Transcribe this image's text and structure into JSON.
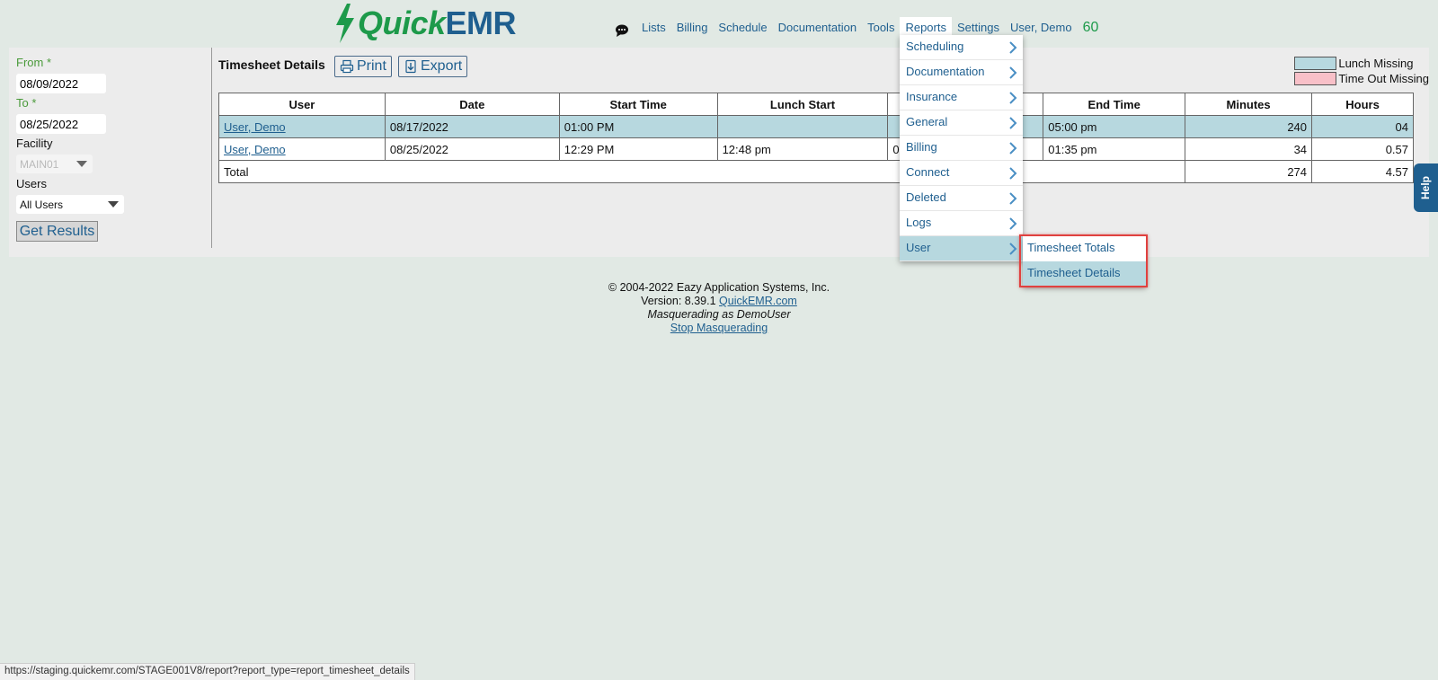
{
  "header": {
    "logo": {
      "quick": "Quick",
      "emr": "EMR"
    },
    "nav": [
      {
        "key": "lists",
        "label": "Lists"
      },
      {
        "key": "billing",
        "label": "Billing"
      },
      {
        "key": "schedule",
        "label": "Schedule"
      },
      {
        "key": "documentation",
        "label": "Documentation"
      },
      {
        "key": "tools",
        "label": "Tools"
      },
      {
        "key": "reports",
        "label": "Reports",
        "active": true
      },
      {
        "key": "settings",
        "label": "Settings"
      },
      {
        "key": "user",
        "label": "User, Demo"
      }
    ],
    "count": "60",
    "chat_icon": "chat-bubble-icon"
  },
  "sidebar": {
    "from_label": "From *",
    "from_value": "08/09/2022",
    "to_label": "To *",
    "to_value": "08/25/2022",
    "facility_label": "Facility",
    "facility_value": "MAIN01",
    "users_label": "Users",
    "users_value": "All Users",
    "get_results_label": "Get Results"
  },
  "report": {
    "title": "Timesheet Details",
    "print_label": "Print",
    "export_label": "Export",
    "legend": [
      {
        "label": "Lunch Missing",
        "color": "#b7d8df"
      },
      {
        "label": "Time Out Missing",
        "color": "#f8c0c8"
      }
    ],
    "columns": [
      "User",
      "Date",
      "Start Time",
      "Lunch Start",
      "",
      "End Time",
      "Minutes",
      "Hours"
    ],
    "rows": [
      {
        "user": "User, Demo",
        "date": "08/17/2022",
        "start": "01:00 PM",
        "lunch_start": "",
        "lunch_end": "",
        "end": "05:00 pm",
        "minutes": "240",
        "hours": "04",
        "lunch_missing": true
      },
      {
        "user": "User, Demo",
        "date": "08/25/2022",
        "start": "12:29 PM",
        "lunch_start": "12:48 pm",
        "lunch_end": "0",
        "end": "01:35 pm",
        "minutes": "34",
        "hours": "0.57",
        "lunch_missing": false
      }
    ],
    "total": {
      "label": "Total",
      "minutes": "274",
      "hours": "4.57"
    }
  },
  "reports_menu": {
    "items": [
      "Scheduling",
      "Documentation",
      "Insurance",
      "General",
      "Billing",
      "Connect",
      "Deleted",
      "Logs",
      "User"
    ],
    "active_item": "User",
    "submenu": [
      "Timesheet Totals",
      "Timesheet Details"
    ],
    "active_subitem": "Timesheet Details"
  },
  "help_label": "Help",
  "footer": {
    "copyright": "© 2004-2022 Eazy Application Systems, Inc.",
    "version_prefix": "Version: 8.39.1 ",
    "version_link": "QuickEMR.com",
    "masquerading": "Masquerading as DemoUser",
    "stop_link": "Stop Masquerading"
  },
  "status_url": "https://staging.quickemr.com/STAGE001V8/report?report_type=report_timesheet_details"
}
